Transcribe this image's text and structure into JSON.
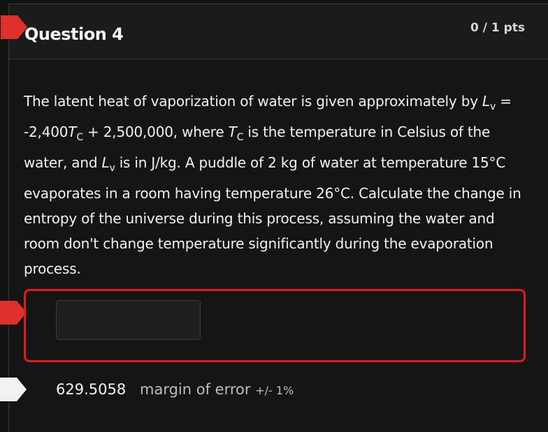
{
  "question": {
    "title": "Question 4",
    "points": "0 / 1 pts",
    "text": {
      "line1_prefix": "The latent heat of vaporization of water is given approximately by ",
      "Lv_L": "L",
      "Lv_sub": "v",
      "line1_eq": "= -2,400",
      "Tc_T": "T",
      "Tc_sub": "C",
      "plus_value": " + 2,500,000, where ",
      "where_rest": " is the temperature in Celsius of the water, and ",
      "units_text": " is in J/kg. A puddle of 2 kg of water at temperature 15°C evaporates in a room having temperature 26°C.  Calculate the change in entropy of the universe during this process, assuming the water and room don't change temperature significantly during the evaporation process."
    }
  },
  "answer": {
    "input_value": "",
    "correct_value": "629.5058",
    "margin_label": "margin of error",
    "margin_value": "+/- 1%"
  },
  "colors": {
    "incorrect_flag": "#e0302d",
    "correct_flag": "#f2f2f2",
    "answer_border": "#e41a1a"
  }
}
